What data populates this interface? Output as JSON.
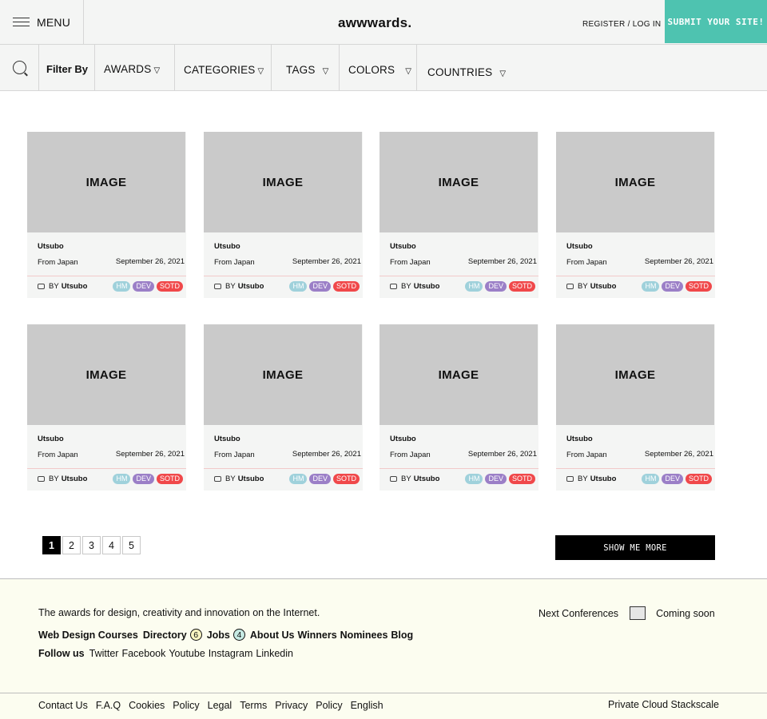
{
  "header": {
    "menu_label": "MENU",
    "logo": "awwwards.",
    "register": "REGISTER / LOG IN",
    "submit": "SUBMIT YOUR SITE!",
    "accent_color": "#4ec3b0"
  },
  "filters": {
    "label": "Filter By",
    "items": [
      "AWARDS",
      "CATEGORIES",
      "TAGS",
      "COLORS",
      "COUNTRIES"
    ],
    "dropdown_glyph": "▽"
  },
  "cards": [
    {
      "image": "IMAGE",
      "title": "Utsubo",
      "from": "From Japan",
      "date": "September 26, 2021",
      "by": "BY",
      "author": "Utsubo",
      "badges": [
        "HM",
        "DEV",
        "SOTD"
      ]
    },
    {
      "image": "IMAGE",
      "title": "Utsubo",
      "from": "From Japan",
      "date": "September 26, 2021",
      "by": "BY",
      "author": "Utsubo",
      "badges": [
        "HM",
        "DEV",
        "SOTD"
      ]
    },
    {
      "image": "IMAGE",
      "title": "Utsubo",
      "from": "From Japan",
      "date": "September 26, 2021",
      "by": "BY",
      "author": "Utsubo",
      "badges": [
        "HM",
        "DEV",
        "SOTD"
      ]
    },
    {
      "image": "IMAGE",
      "title": "Utsubo",
      "from": "From Japan",
      "date": "September 26, 2021",
      "by": "BY",
      "author": "Utsubo",
      "badges": [
        "HM",
        "DEV",
        "SOTD"
      ]
    },
    {
      "image": "IMAGE",
      "title": "Utsubo",
      "from": "From Japan",
      "date": "September 26, 2021",
      "by": "BY",
      "author": "Utsubo",
      "badges": [
        "HM",
        "DEV",
        "SOTD"
      ]
    },
    {
      "image": "IMAGE",
      "title": "Utsubo",
      "from": "From Japan",
      "date": "September 26, 2021",
      "by": "BY",
      "author": "Utsubo",
      "badges": [
        "HM",
        "DEV",
        "SOTD"
      ]
    },
    {
      "image": "IMAGE",
      "title": "Utsubo",
      "from": "From Japan",
      "date": "September 26, 2021",
      "by": "BY",
      "author": "Utsubo",
      "badges": [
        "HM",
        "DEV",
        "SOTD"
      ]
    },
    {
      "image": "IMAGE",
      "title": "Utsubo",
      "from": "From Japan",
      "date": "September 26, 2021",
      "by": "BY",
      "author": "Utsubo",
      "badges": [
        "HM",
        "DEV",
        "SOTD"
      ]
    }
  ],
  "pagination": {
    "pages": [
      "1",
      "2",
      "3",
      "4",
      "5"
    ],
    "current": "1"
  },
  "show_more": "SHOW ME MORE",
  "footer": {
    "tagline": "The awards for design, creativity and innovation on the Internet.",
    "nav": {
      "web_design_courses": "Web Design Courses",
      "directory": "Directory",
      "directory_count": "6",
      "jobs": "Jobs",
      "jobs_count": "4",
      "about_us": "About Us",
      "winners": "Winners",
      "nominees": "Nominees",
      "blog": "Blog"
    },
    "follow_label": "Follow us",
    "social": [
      "Twitter",
      "Facebook",
      "Youtube",
      "Instagram",
      "Linkedin"
    ],
    "next_conferences": "Next Conferences",
    "coming_soon": "Coming soon",
    "legal": [
      "Contact Us",
      "F.A.Q",
      "Cookies",
      "Policy",
      "Legal",
      "Terms",
      "Privacy",
      "Policy",
      "English"
    ],
    "cloud": "Private Cloud Stackscale"
  }
}
